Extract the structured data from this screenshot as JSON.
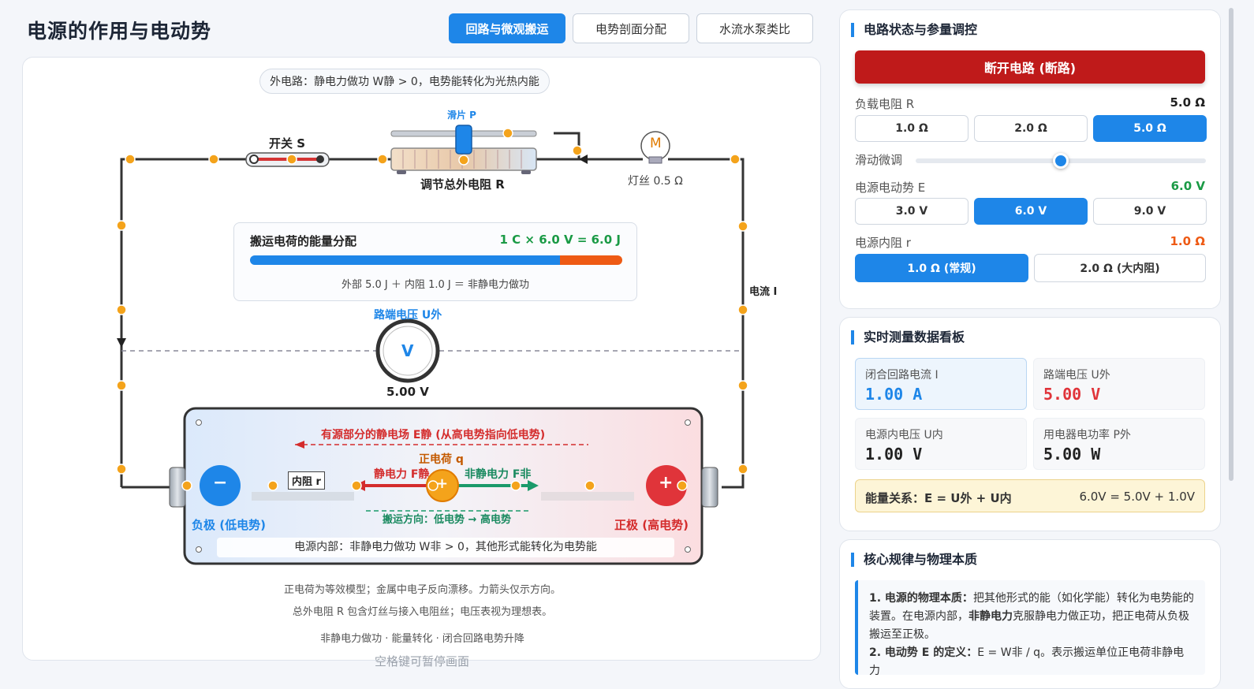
{
  "header": {
    "title": "电源的作用与电动势",
    "tabs": [
      {
        "label": "回路与微观搬运"
      },
      {
        "label": "电势剖面分配"
      },
      {
        "label": "水流水泵类比"
      }
    ]
  },
  "diagram": {
    "ext_note": "外电路：静电力做功 W静 > 0，电势能转化为光热内能",
    "switch_label": "开关 S",
    "slider_label": "滑片 P",
    "rheostat_label": "调节总外电阻 R",
    "lamp_label": "灯丝 0.5 Ω",
    "lamp_glyph": "M",
    "current_label": "电流 I",
    "voltmeter_label": "路端电压 U外",
    "voltmeter_glyph": "V",
    "voltmeter_reading": "5.00 V",
    "energy": {
      "title": "搬运电荷的能量分配",
      "equation": "1 C × 6.0 V = 6.0 J",
      "external_fraction": 0.833,
      "internal_fraction": 0.167,
      "note": "外部 5.0 J ＋ 内阻 1.0 J ＝ 非静电力做功"
    },
    "source": {
      "field_label": "有源部分的静电场 E静 (从高电势指向低电势)",
      "charge_label": "正电荷 q",
      "electric_force": "静电力 F静",
      "nonelectric_force": "非静电力 F非",
      "direction": "搬运方向：低电势 → 高电势",
      "internal_r": "内阻 r",
      "neg_label": "负极 (低电势)",
      "pos_label": "正极 (高电势)",
      "neg_sign": "−",
      "pos_sign": "+",
      "inside_note": "电源内部：非静电力做功 W非 > 0，其他形式能转化为电势能"
    },
    "footnotes": [
      "正电荷为等效模型；金属中电子反向漂移。力箭头仅示方向。",
      "总外电阻 R 包含灯丝与接入电阻丝；电压表视为理想表。",
      "非静电力做功 · 能量转化 · 闭合回路电势升降"
    ],
    "pause_hint": "空格键可暂停画面"
  },
  "controls": {
    "title": "电路状态与参量调控",
    "toggle_label": "断开电路 (断路)",
    "load": {
      "label": "负载电阻 R",
      "value": "5.0 Ω",
      "options": [
        "1.0 Ω",
        "2.0 Ω",
        "5.0 Ω"
      ],
      "selected": 2
    },
    "fine": {
      "label": "滑动微调",
      "level": 0.5
    },
    "emf": {
      "label": "电源电动势 E",
      "value": "6.0 V",
      "options": [
        "3.0 V",
        "6.0 V",
        "9.0 V"
      ],
      "selected": 1
    },
    "internal": {
      "label": "电源内阻 r",
      "value": "1.0 Ω",
      "options": [
        "1.0 Ω (常规)",
        "2.0 Ω (大内阻)"
      ],
      "selected": 0
    }
  },
  "readings": {
    "title": "实时测量数据看板",
    "items": [
      {
        "label": "闭合回路电流 I",
        "value": "1.00 A"
      },
      {
        "label": "路端电压 U外",
        "value": "5.00 V"
      },
      {
        "label": "电源内电压 U内",
        "value": "1.00 V"
      },
      {
        "label": "用电器电功率 P外",
        "value": "5.00 W"
      }
    ],
    "relation_label": "能量关系：E = U外 + U内",
    "relation_value": "6.0V = 5.0V + 1.0V"
  },
  "laws": {
    "title": "核心规律与物理本质",
    "p1_head": "1. 电源的物理本质：",
    "p1_text": "把其他形式的能（如化学能）转化为电势能的装置。在电源内部，",
    "p1_bold": "非静电力",
    "p1_tail": "克服静电力做正功，把正电荷从负极搬运至正极。",
    "p2_head": "2. 电动势 E 的定义：",
    "p2_text": "E = W非 / q。表示搬运单位正电荷非静电力"
  },
  "colors": {
    "accent": "#1e86e8",
    "danger": "#bf1a1a",
    "positive": "#e0343a",
    "green": "#1a9a45",
    "orange": "#ee5a14"
  }
}
